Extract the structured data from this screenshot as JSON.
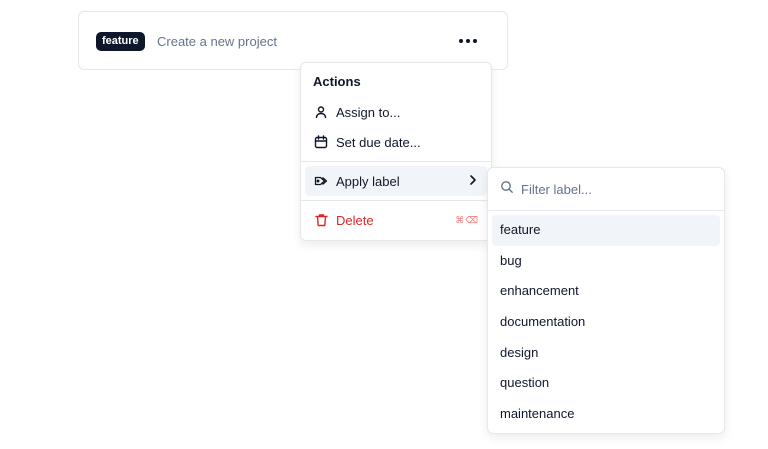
{
  "task": {
    "badge": "feature",
    "title": "Create a new project"
  },
  "menu": {
    "heading": "Actions",
    "items": [
      {
        "label": "Assign to...",
        "icon": "user-icon"
      },
      {
        "label": "Set due date...",
        "icon": "calendar-icon"
      },
      {
        "label": "Apply label",
        "icon": "tag-icon"
      },
      {
        "label": "Delete",
        "icon": "trash-icon",
        "shortcut": "⌘⌫"
      }
    ]
  },
  "label_filter": {
    "placeholder": "Filter label...",
    "options": [
      "feature",
      "bug",
      "enhancement",
      "documentation",
      "design",
      "question",
      "maintenance"
    ]
  },
  "colors": {
    "badge_bg": "#0f172a",
    "danger": "#dc2626",
    "highlight": "#f1f5f9",
    "border": "#e5e7eb"
  }
}
